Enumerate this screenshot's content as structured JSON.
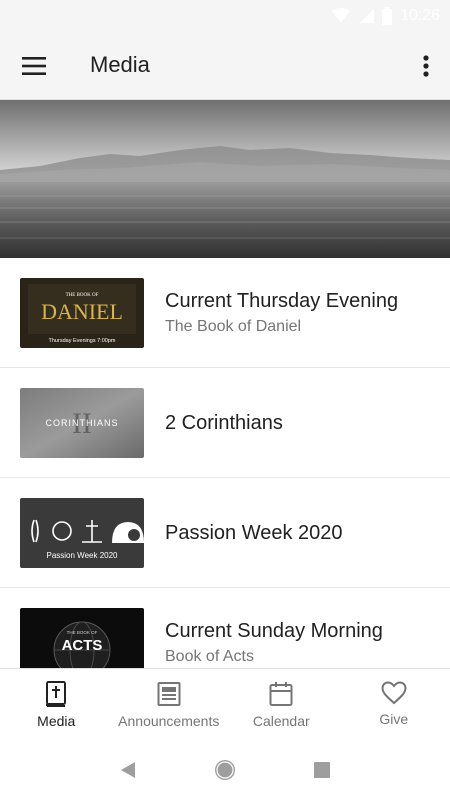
{
  "status_bar": {
    "time": "10:26",
    "icons": [
      "wifi-icon",
      "signal-icon",
      "battery-icon"
    ]
  },
  "app_bar": {
    "title": "Media",
    "menu_icon": "hamburger-menu-icon",
    "overflow_icon": "more-vert-icon"
  },
  "hero": {
    "description_icon": "hero-banner-image"
  },
  "media_items": [
    {
      "title": "Current Thursday Evening",
      "subtitle": "The Book of Daniel",
      "thumb_top": "THE BOOK OF",
      "thumb_main": "DANIEL",
      "thumb_bottom": "Thursday Evenings 7:00pm"
    },
    {
      "title": "2 Corinthians",
      "subtitle": "",
      "thumb_roman": "II",
      "thumb_main": "CORINTHIANS"
    },
    {
      "title": "Passion Week 2020",
      "subtitle": "",
      "thumb_main": "Passion Week 2020"
    },
    {
      "title": "Current Sunday Morning",
      "subtitle": "Book of Acts",
      "thumb_top": "THE BOOK OF",
      "thumb_main": "ACTS"
    }
  ],
  "bottom_nav": [
    {
      "label": "Media",
      "icon": "bible-icon",
      "active": true
    },
    {
      "label": "Announcements",
      "icon": "newspaper-icon",
      "active": false
    },
    {
      "label": "Calendar",
      "icon": "calendar-icon",
      "active": false
    },
    {
      "label": "Give",
      "icon": "heart-icon",
      "active": false
    }
  ],
  "system_nav": [
    "back-icon",
    "home-icon",
    "recents-icon"
  ],
  "colors": {
    "app_bar_bg": "#f5f5f5",
    "text_primary": "#212121",
    "text_secondary": "#757575",
    "divider": "#e8e8e8",
    "daniel_gold": "#d9b44a"
  }
}
